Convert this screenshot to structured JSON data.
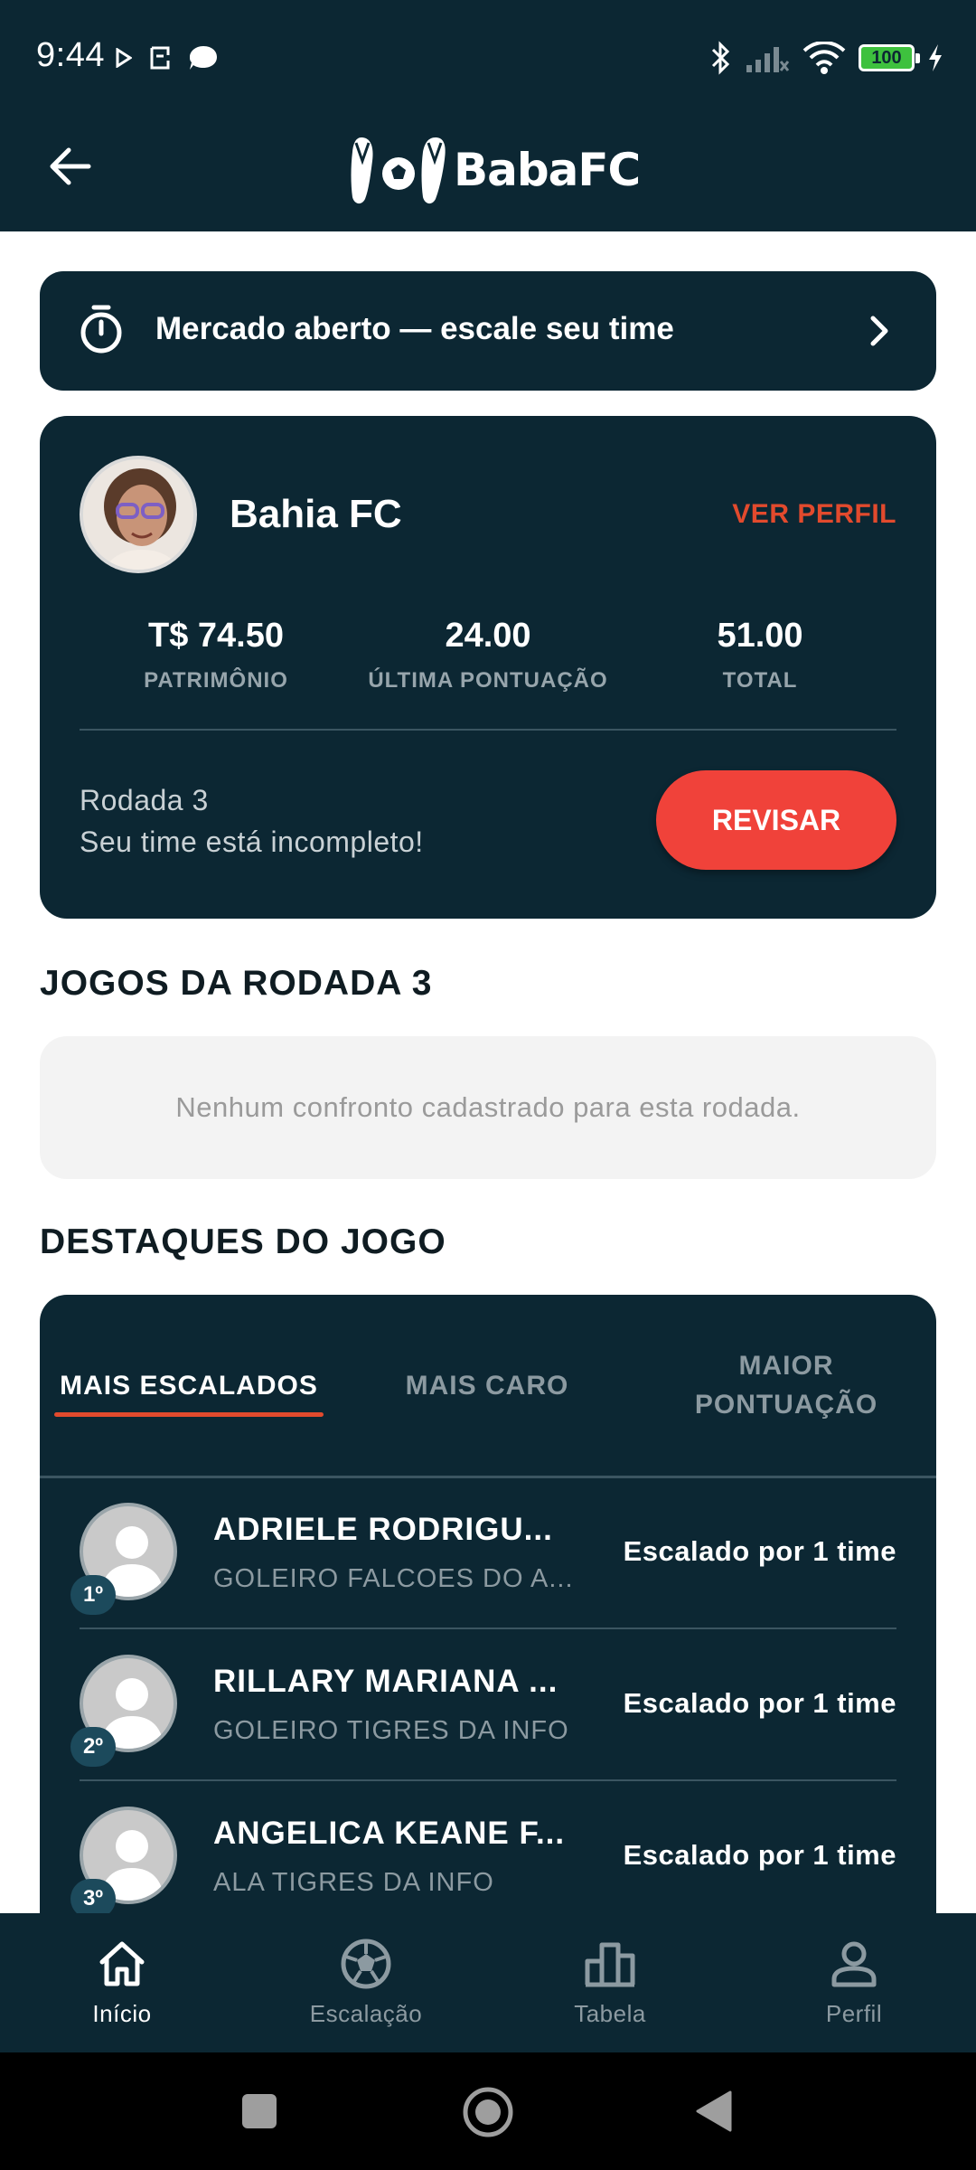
{
  "status_bar": {
    "time": "9:44",
    "battery": "100"
  },
  "app_bar": {
    "logo_text": "BabaFC"
  },
  "market": {
    "text": "Mercado aberto — escale seu time"
  },
  "team": {
    "name": "Bahia FC",
    "view_profile": "VER PERFIL",
    "stats": [
      {
        "value": "T$ 74.50",
        "label": "PATRIMÔNIO"
      },
      {
        "value": "24.00",
        "label": "ÚLTIMA PONTUAÇÃO"
      },
      {
        "value": "51.00",
        "label": "TOTAL"
      }
    ],
    "round": "Rodada 3",
    "status": "Seu time está incompleto!",
    "review_button": "REVISAR"
  },
  "games": {
    "title": "JOGOS DA RODADA 3",
    "empty_message": "Nenhum confronto cadastrado para esta rodada."
  },
  "highlights": {
    "title": "DESTAQUES DO JOGO",
    "tabs": [
      {
        "label": "MAIS ESCALADOS",
        "active": true
      },
      {
        "label": "MAIS CARO",
        "active": false
      },
      {
        "label": "MAIOR PONTUAÇÃO",
        "active": false
      }
    ],
    "players": [
      {
        "rank": "1º",
        "name": "ADRIELE  RODRIGU...",
        "position": "GOLEIRO FALCOES DO A...",
        "count": "Escalado por 1 time"
      },
      {
        "rank": "2º",
        "name": "RILLARY MARIANA ...",
        "position": "GOLEIRO TIGRES DA INFO",
        "count": "Escalado por 1 time"
      },
      {
        "rank": "3º",
        "name": "ANGELICA KEANE F...",
        "position": "ALA TIGRES DA INFO",
        "count": "Escalado por 1 time"
      }
    ]
  },
  "bottom_nav": [
    {
      "label": "Início",
      "icon": "home-icon",
      "active": true
    },
    {
      "label": "Escalação",
      "icon": "soccer-ball-icon",
      "active": false
    },
    {
      "label": "Tabela",
      "icon": "bar-chart-icon",
      "active": false
    },
    {
      "label": "Perfil",
      "icon": "person-icon",
      "active": false
    }
  ],
  "colors": {
    "primary_dark": "#0c2733",
    "accent_orange": "#e24a2d",
    "button_red": "#f0423a"
  }
}
